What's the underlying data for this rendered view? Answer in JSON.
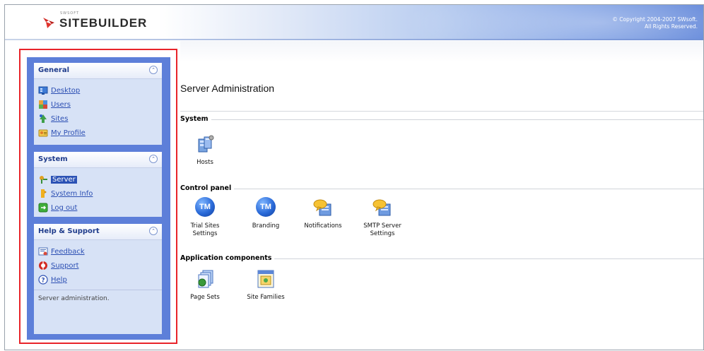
{
  "header": {
    "logo_small": "SWSOFT",
    "logo_text": "SITEBUILDER",
    "copyright_line1": "© Copyright 2004-2007 SWsoft.",
    "copyright_line2": "All Rights Reserved."
  },
  "sidebar": {
    "panels": [
      {
        "title": "General",
        "items": [
          {
            "label": "Desktop",
            "icon": "desktop-icon"
          },
          {
            "label": "Users",
            "icon": "users-icon"
          },
          {
            "label": "Sites",
            "icon": "sites-icon"
          },
          {
            "label": "My Profile",
            "icon": "profile-icon"
          }
        ]
      },
      {
        "title": "System",
        "items": [
          {
            "label": "Server",
            "icon": "server-icon",
            "active": true
          },
          {
            "label": "System Info",
            "icon": "info-icon"
          },
          {
            "label": "Log out",
            "icon": "logout-icon"
          }
        ]
      },
      {
        "title": "Help & Support",
        "items": [
          {
            "label": "Feedback",
            "icon": "feedback-icon"
          },
          {
            "label": "Support",
            "icon": "support-icon"
          },
          {
            "label": "Help",
            "icon": "help-icon"
          }
        ],
        "note": "Server administration."
      }
    ]
  },
  "main": {
    "title": "Server Administration",
    "sections": [
      {
        "title": "System",
        "tiles": [
          {
            "label": "Hosts",
            "icon": "hosts-icon"
          }
        ]
      },
      {
        "title": "Control panel",
        "tiles": [
          {
            "label": "Trial Sites Settings",
            "icon": "tm-icon"
          },
          {
            "label": "Branding",
            "icon": "tm-icon"
          },
          {
            "label": "Notifications",
            "icon": "notifications-icon"
          },
          {
            "label": "SMTP Server Settings",
            "icon": "smtp-icon"
          }
        ]
      },
      {
        "title": "Application components",
        "tiles": [
          {
            "label": "Page Sets",
            "icon": "page-sets-icon"
          },
          {
            "label": "Site Families",
            "icon": "site-families-icon"
          }
        ]
      }
    ]
  },
  "colors": {
    "sidebar_bg": "#5d7fd9",
    "panel_bg": "#d7e2f6",
    "link": "#2c4fb3",
    "highlight_border": "#e8242a"
  }
}
